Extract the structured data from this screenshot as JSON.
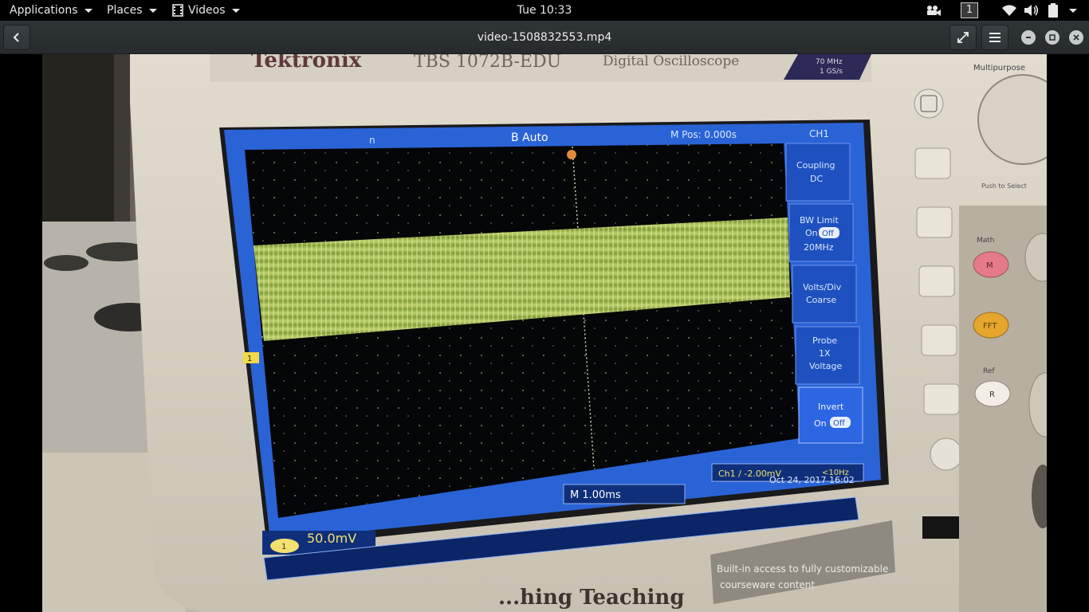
{
  "topbar": {
    "applications_label": "Applications",
    "places_label": "Places",
    "videos_label": "Videos",
    "clock": "Tue 10:33",
    "workspace_number": "1"
  },
  "headerbar": {
    "title": "video-1508832553.mp4"
  },
  "video_frame": {
    "brand_text": "Tektronix",
    "model_text": "TBS 1072B-EDU",
    "product_text": "Digital Oscilloscope",
    "badge_line1": "70 MHz",
    "badge_line2": "1 GS/s",
    "screen": {
      "top_marker": "n",
      "trigger_mode": "B Auto",
      "position_readout": "M Pos: 0.000s",
      "menu_title": "CH1",
      "menu_coupling_line1": "Coupling",
      "menu_coupling_line2": "DC",
      "menu_bwlimit_line1": "BW Limit",
      "menu_bwlimit_line2": "On",
      "menu_bwlimit_off": "Off",
      "menu_bwlimit_line3": "20MHz",
      "menu_voltsdiv_line1": "Volts/Div",
      "menu_voltsdiv_line2": "Coarse",
      "menu_probe_line1": "Probe",
      "menu_probe_line2": "1X",
      "menu_probe_line3": "Voltage",
      "menu_invert_line1": "Invert",
      "menu_invert_line2": "On",
      "menu_invert_off": "Off",
      "ch1_marker": "1",
      "timebase": "M 1.00ms",
      "trigger_readout": "Ch1 / -2.00mV",
      "trigger_freq": "<10Hz",
      "datetime": "Oct 24, 2017 16:02",
      "ch1_label": "1",
      "ch1_scale": "50.0mV"
    },
    "right_panel_label_top": "Multipurpose",
    "right_panel_label_pushbutton": "Push to Select",
    "math_label": "Math",
    "math_button": "M",
    "fft_button": "FFT",
    "ref_label": "Ref",
    "ref_button": "R",
    "bottom_tagline": "...hing Teaching",
    "bottom_info_line1": "Built-in access to fully customizable",
    "bottom_info_line2": "courseware content"
  },
  "colors": {
    "topbar_bg": "#000000",
    "headerbar_bg": "#2f3437",
    "trace": "#a8c248",
    "screen_blue": "#2a63d6"
  }
}
